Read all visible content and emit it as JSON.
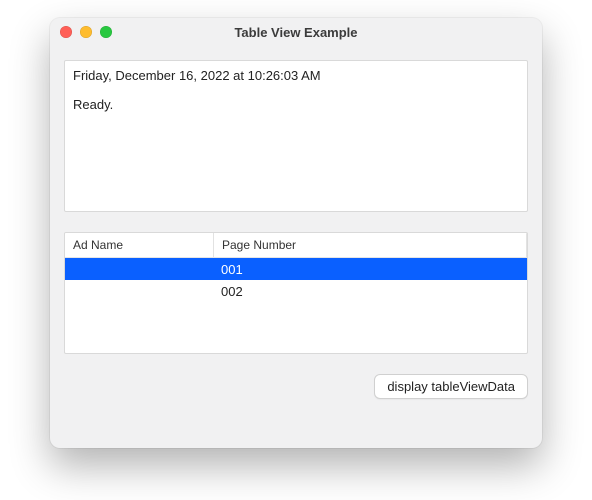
{
  "window": {
    "title": "Table View Example"
  },
  "log": {
    "timestamp": "Friday, December 16, 2022 at 10:26:03 AM",
    "status": "Ready."
  },
  "table": {
    "columns": {
      "ad_name": "Ad Name",
      "page_number": "Page Number"
    },
    "rows": [
      {
        "ad_name": "",
        "page_number": "001",
        "selected": true
      },
      {
        "ad_name": "",
        "page_number": "002",
        "selected": false
      }
    ]
  },
  "buttons": {
    "display_data": "display tableViewData"
  }
}
